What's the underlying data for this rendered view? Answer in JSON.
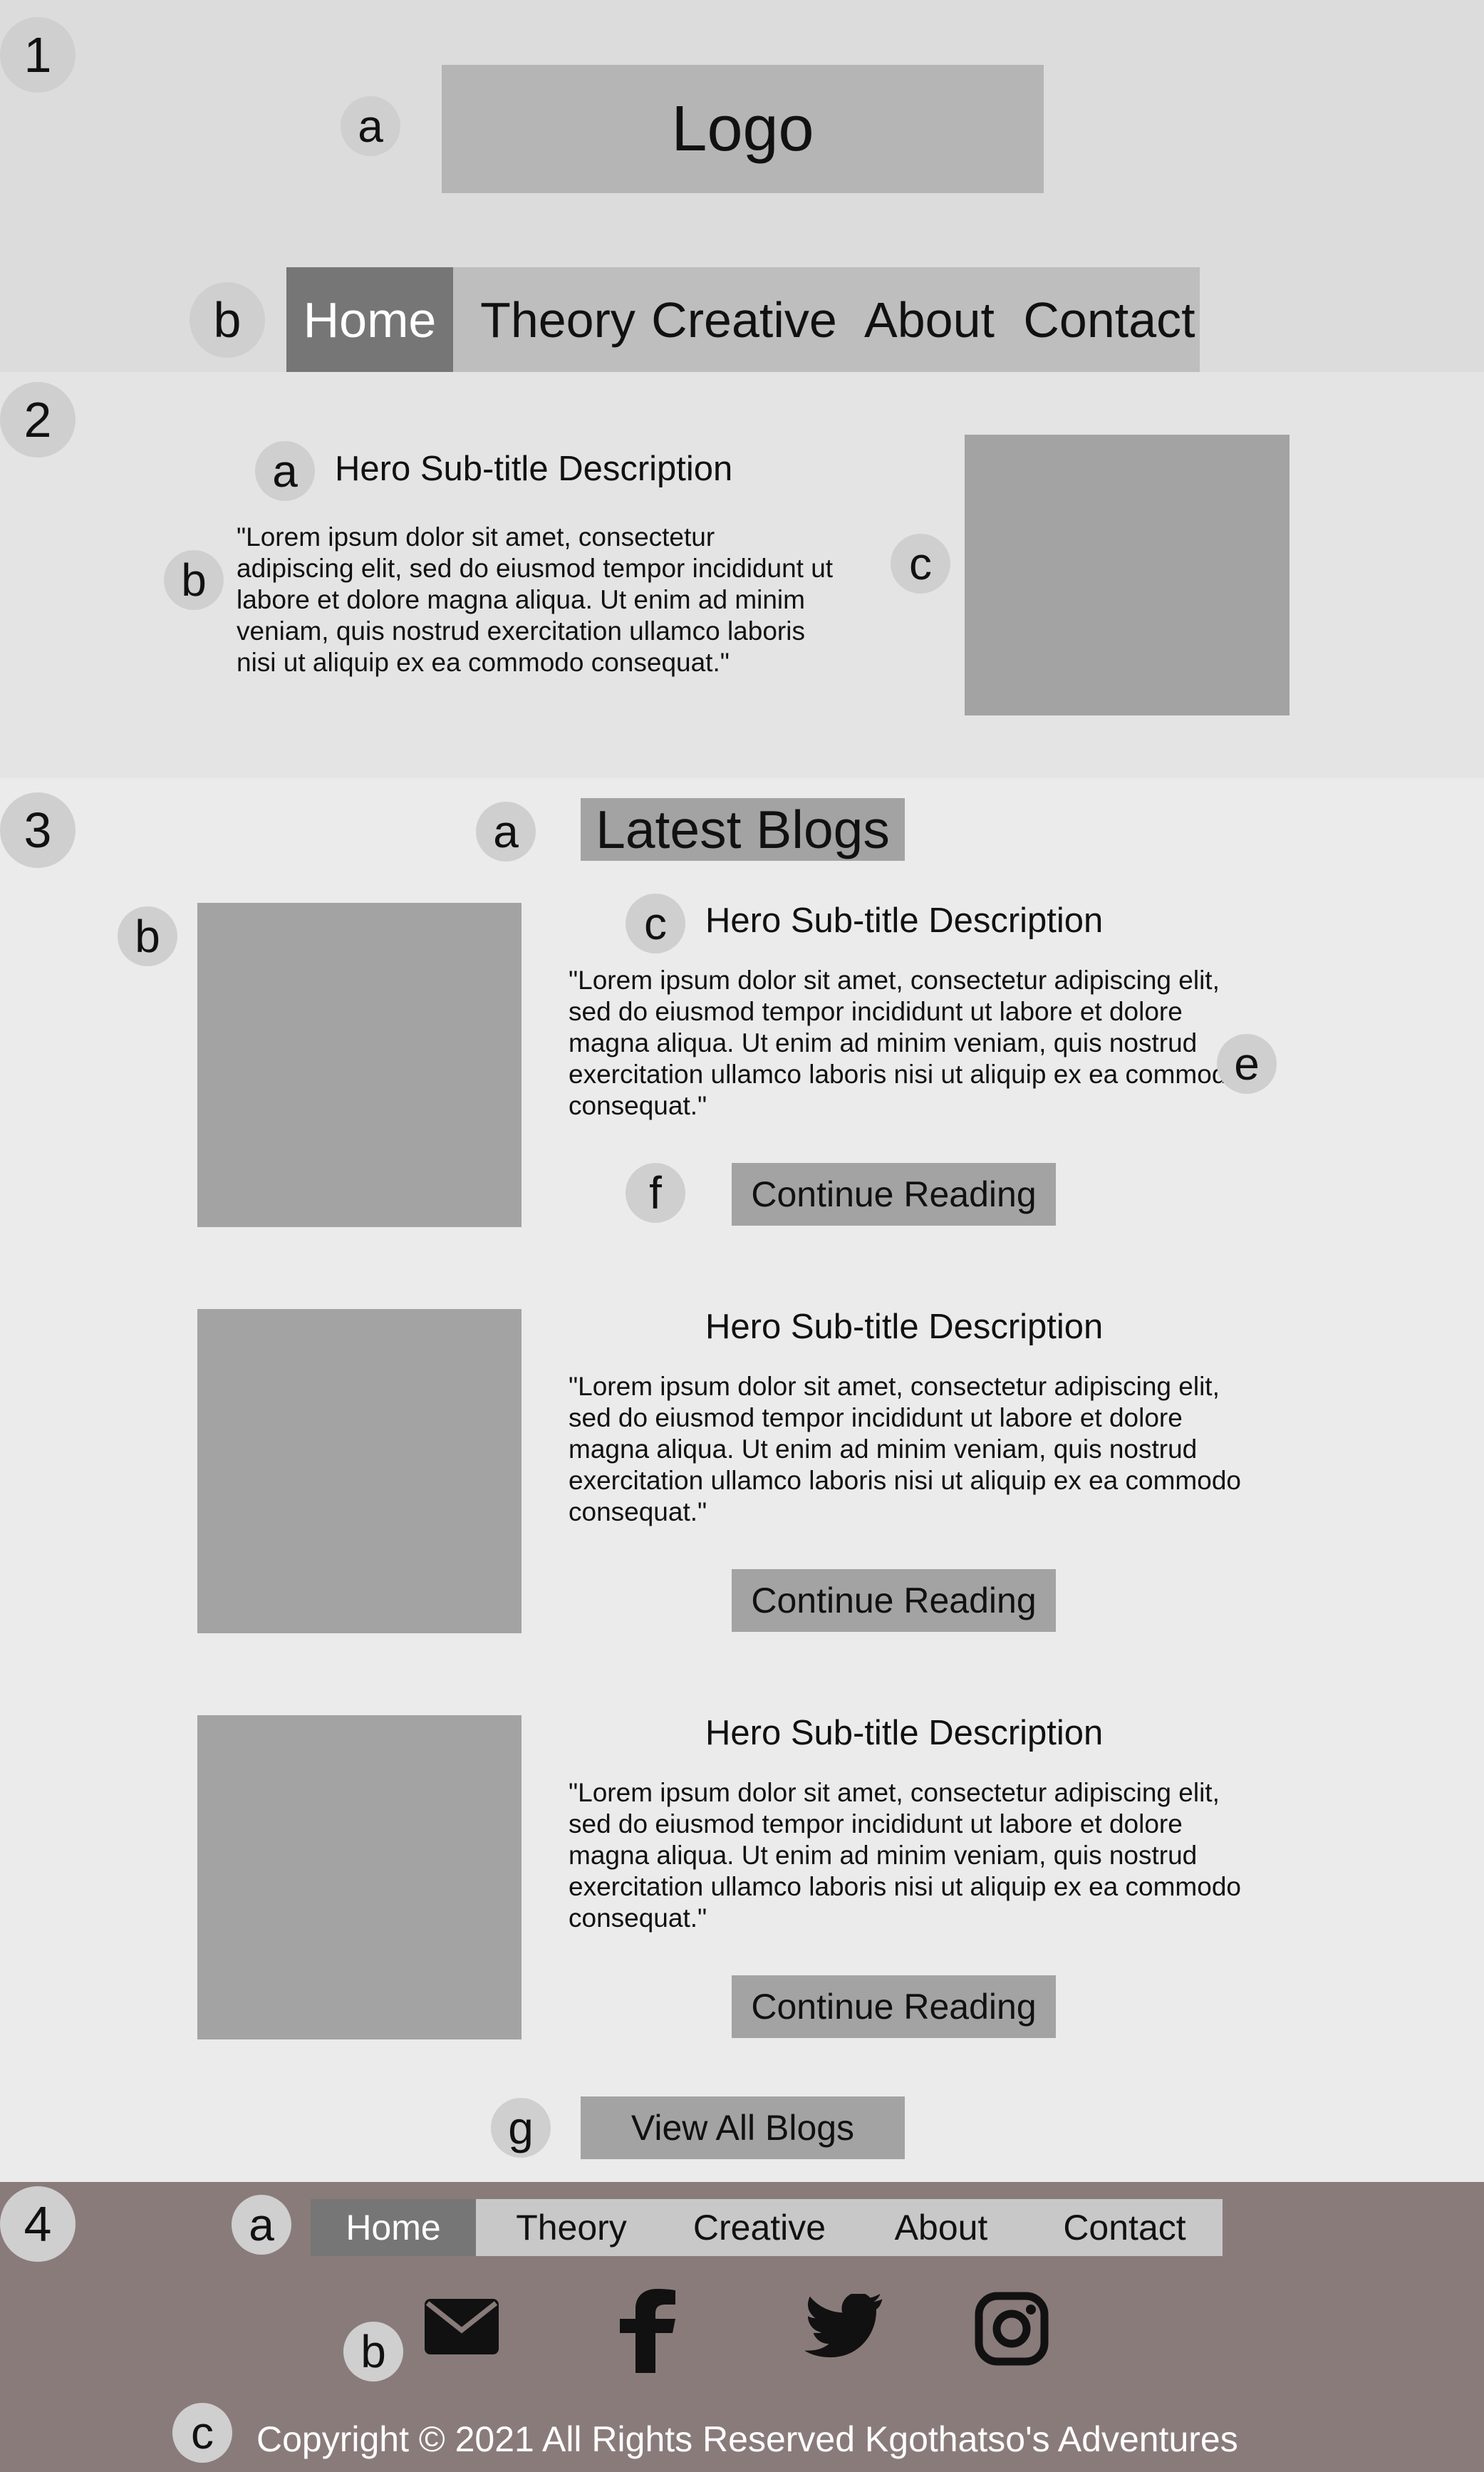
{
  "markers": {
    "s1": "1",
    "s1a": "a",
    "s1b": "b",
    "s2": "2",
    "s2a": "a",
    "s2b": "b",
    "s2c": "c",
    "s3": "3",
    "s3a": "a",
    "s3b": "b",
    "s3c": "c",
    "s3e": "e",
    "s3f": "f",
    "s3g": "g",
    "s4": "4",
    "s4a": "a",
    "s4b": "b",
    "s4c": "c"
  },
  "header": {
    "logo": "Logo",
    "nav": [
      "Home",
      "Theory",
      "Creative",
      "About",
      "Contact"
    ],
    "active": "Home"
  },
  "hero": {
    "subtitle": "Hero Sub-title Description",
    "text": "\"Lorem ipsum dolor sit amet, consectetur adipiscing elit, sed do eiusmod tempor incididunt ut labore et dolore magna aliqua. Ut enim ad minim veniam, quis nostrud exercitation ullamco laboris nisi ut aliquip ex ea commodo consequat.\""
  },
  "blogs": {
    "heading": "Latest Blogs",
    "posts": [
      {
        "title": "Hero Sub-title Description",
        "text": "\"Lorem ipsum dolor sit amet, consectetur adipiscing elit, sed do eiusmod tempor incididunt ut labore et dolore magna aliqua. Ut enim ad minim veniam, quis nostrud exercitation ullamco laboris nisi ut aliquip ex ea commodo consequat.\"",
        "button": "Continue Reading"
      },
      {
        "title": "Hero Sub-title Description",
        "text": "\"Lorem ipsum dolor sit amet, consectetur adipiscing elit, sed do eiusmod tempor incididunt ut labore et dolore magna aliqua. Ut enim ad minim veniam, quis nostrud exercitation ullamco laboris nisi ut aliquip ex ea commodo consequat.\"",
        "button": "Continue Reading"
      },
      {
        "title": "Hero Sub-title Description",
        "text": "\"Lorem ipsum dolor sit amet, consectetur adipiscing elit, sed do eiusmod tempor incididunt ut labore et dolore magna aliqua. Ut enim ad minim veniam, quis nostrud exercitation ullamco laboris nisi ut aliquip ex ea commodo consequat.\"",
        "button": "Continue Reading"
      }
    ],
    "view_all": "View All Blogs"
  },
  "footer": {
    "nav": [
      "Home",
      "Theory",
      "Creative",
      "About",
      "Contact"
    ],
    "active": "Home",
    "social_icons": [
      "envelope-icon",
      "facebook-icon",
      "twitter-icon",
      "instagram-icon"
    ],
    "copyright": "Copyright © 2021 All Rights Reserved Kgothatso's Adventures"
  },
  "colors": {
    "header_bg": "#dcdcdc",
    "hero_bg": "#e4e4e4",
    "blogs_bg": "#ebebeb",
    "footer_bg": "#8a7b7b",
    "placeholder": "#a3a3a3",
    "nav_active": "#767676",
    "footer_nav_bg": "#c8c8c8"
  }
}
